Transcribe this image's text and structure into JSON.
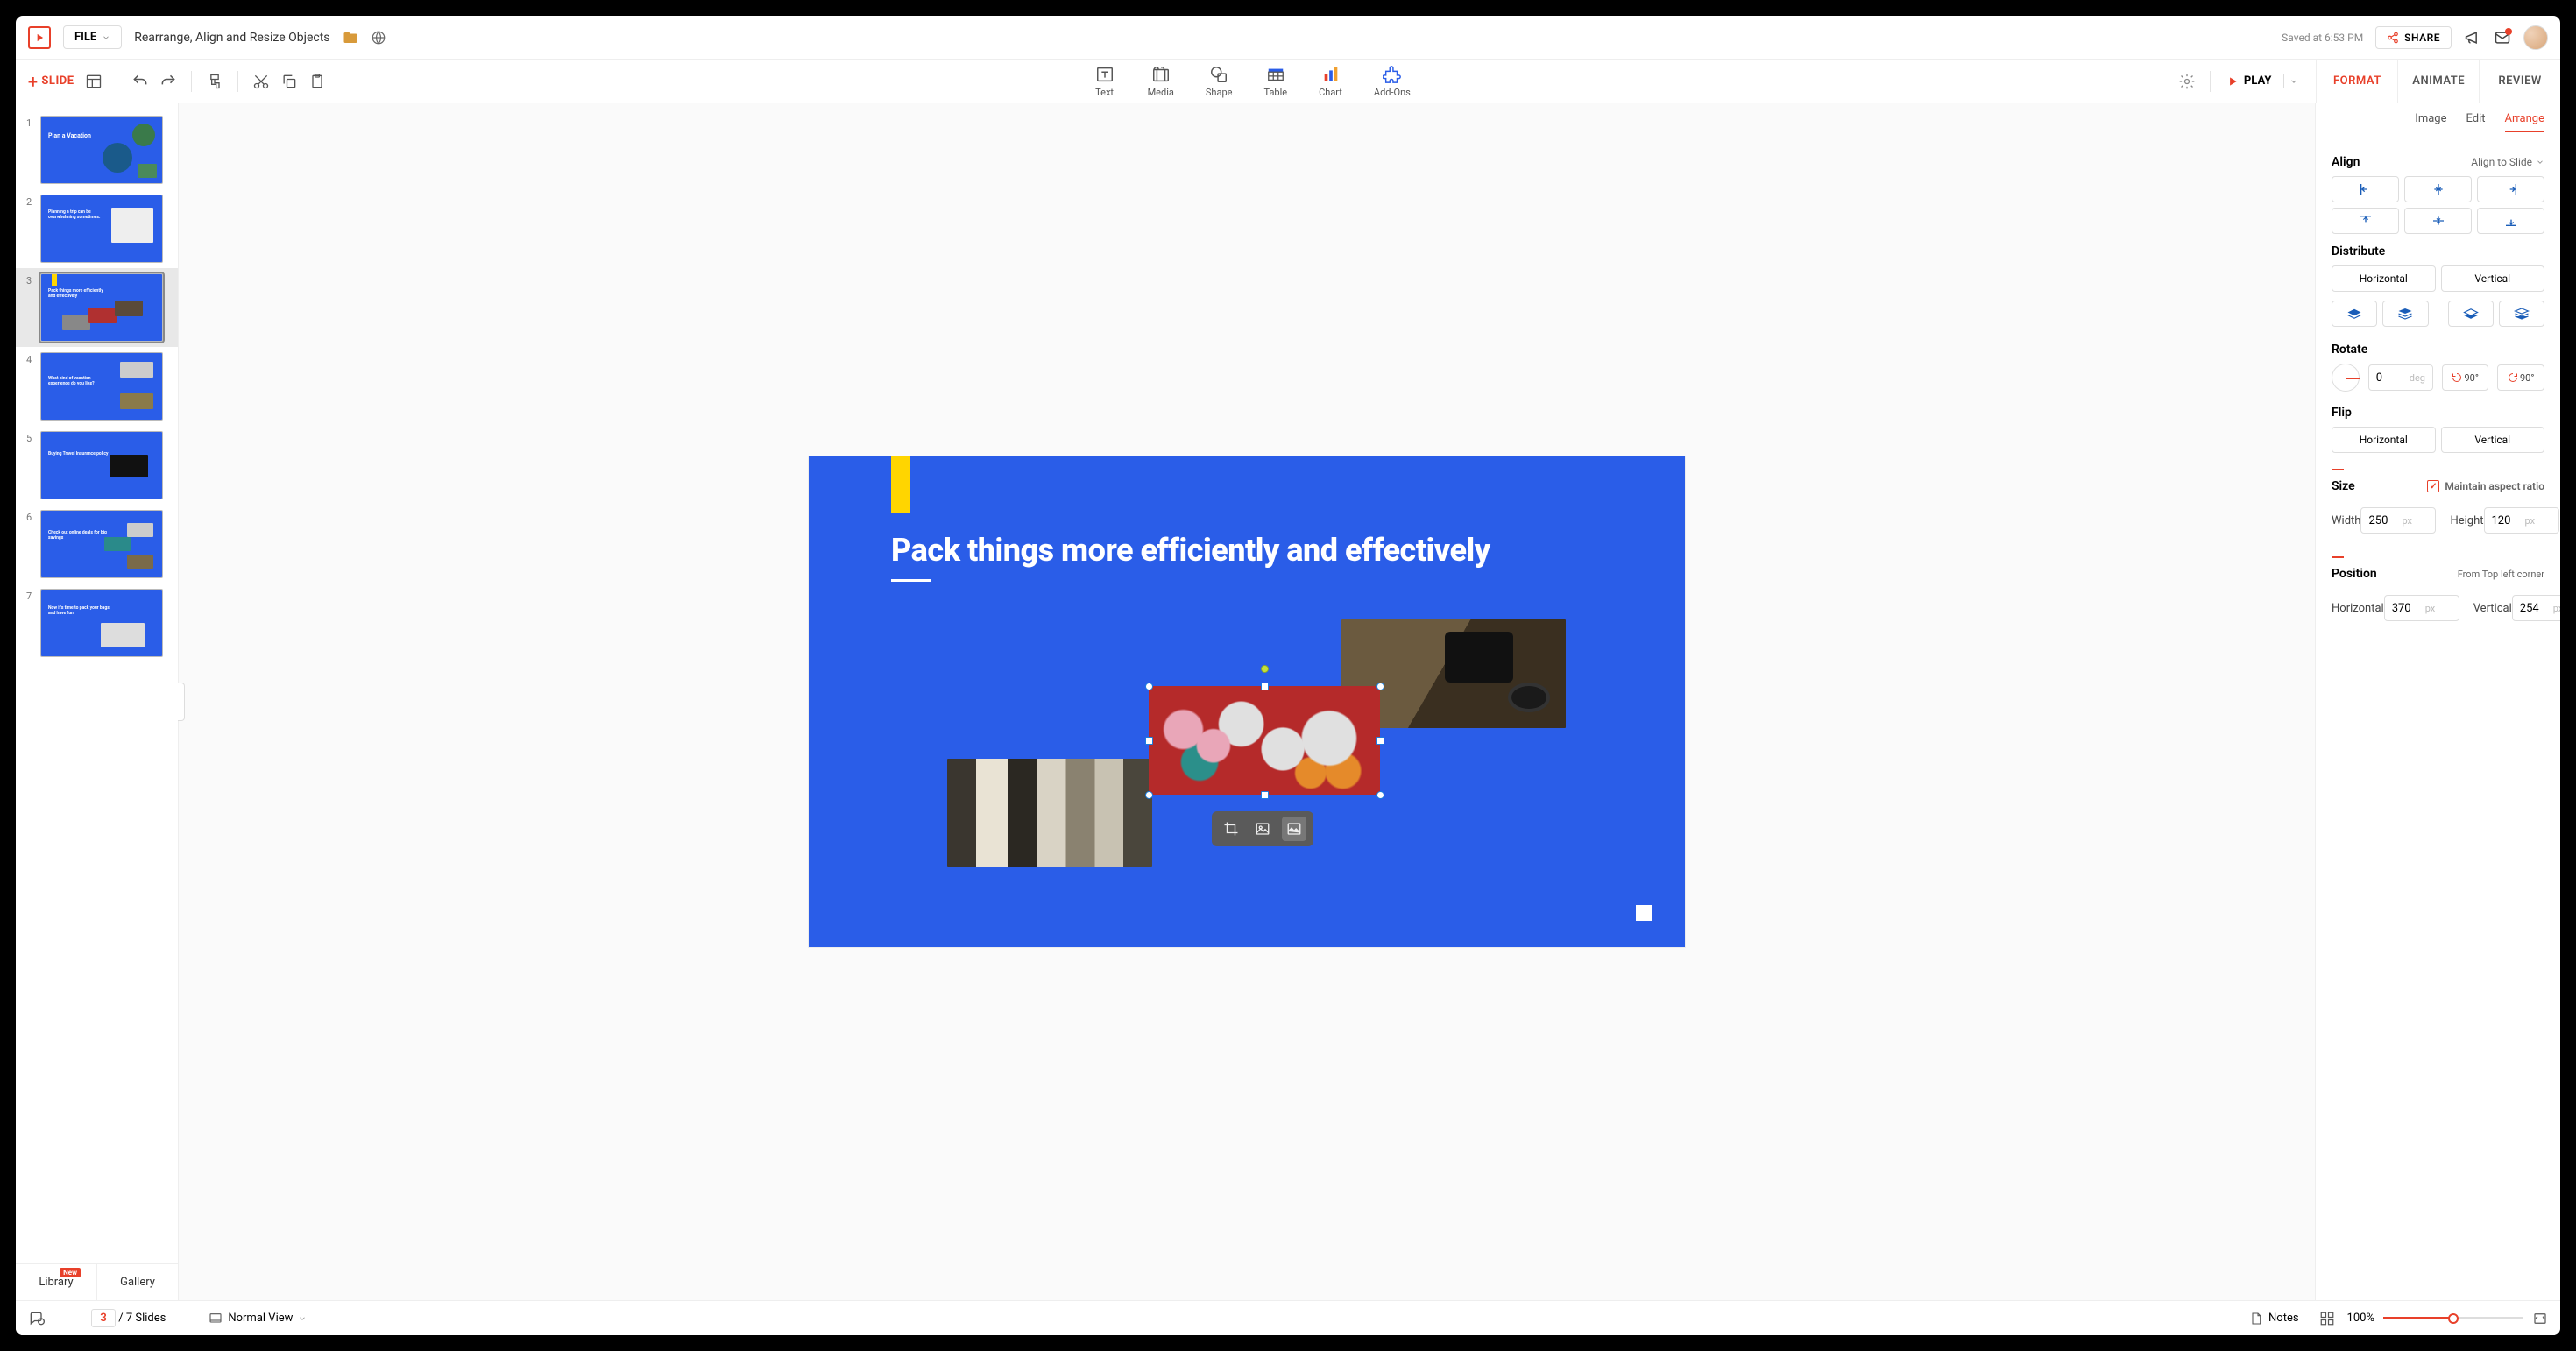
{
  "header": {
    "file_label": "FILE",
    "doc_title": "Rearrange, Align and Resize Objects",
    "saved_text": "Saved at 6:53 PM",
    "share_label": "SHARE"
  },
  "toolbar": {
    "add_slide": "SLIDE",
    "insert": {
      "text": "Text",
      "media": "Media",
      "shape": "Shape",
      "table": "Table",
      "chart": "Chart",
      "addons": "Add-Ons"
    },
    "play": "PLAY"
  },
  "right_tabs": {
    "format": "FORMAT",
    "animate": "ANIMATE",
    "review": "REVIEW"
  },
  "thumbs": {
    "items": [
      {
        "n": "1",
        "title": "Plan a Vacation"
      },
      {
        "n": "2",
        "title": "Planning a trip can be overwhelming sometimes."
      },
      {
        "n": "3",
        "title": "Pack things more efficiently and effectively"
      },
      {
        "n": "4",
        "title": "What kind of vacation experience do you like?"
      },
      {
        "n": "5",
        "title": "Buying Travel Insurance policy"
      },
      {
        "n": "6",
        "title": "Check out online deals for big savings"
      },
      {
        "n": "7",
        "title": "Now it's time to pack your bags and have fun!"
      }
    ],
    "library": "Library",
    "library_badge": "New",
    "gallery": "Gallery"
  },
  "slide": {
    "title": "Pack things more efficiently and effectively"
  },
  "subtabs": {
    "image": "Image",
    "edit": "Edit",
    "arrange": "Arrange"
  },
  "panel": {
    "align": {
      "title": "Align",
      "scope": "Align to Slide"
    },
    "distribute": {
      "title": "Distribute",
      "horizontal": "Horizontal",
      "vertical": "Vertical"
    },
    "rotate": {
      "title": "Rotate",
      "value": "0",
      "unit": "deg",
      "deg90": "90°"
    },
    "flip": {
      "title": "Flip",
      "horizontal": "Horizontal",
      "vertical": "Vertical"
    },
    "size": {
      "title": "Size",
      "maintain": "Maintain aspect ratio",
      "width_label": "Width",
      "width": "250",
      "height_label": "Height",
      "height": "120",
      "unit": "px"
    },
    "position": {
      "title": "Position",
      "origin": "From Top left corner",
      "h_label": "Horizontal",
      "h": "370",
      "v_label": "Vertical",
      "v": "254",
      "unit": "px"
    }
  },
  "status": {
    "current": "3",
    "total": "/ 7 Slides",
    "view": "Normal View",
    "notes": "Notes",
    "zoom": "100%"
  }
}
